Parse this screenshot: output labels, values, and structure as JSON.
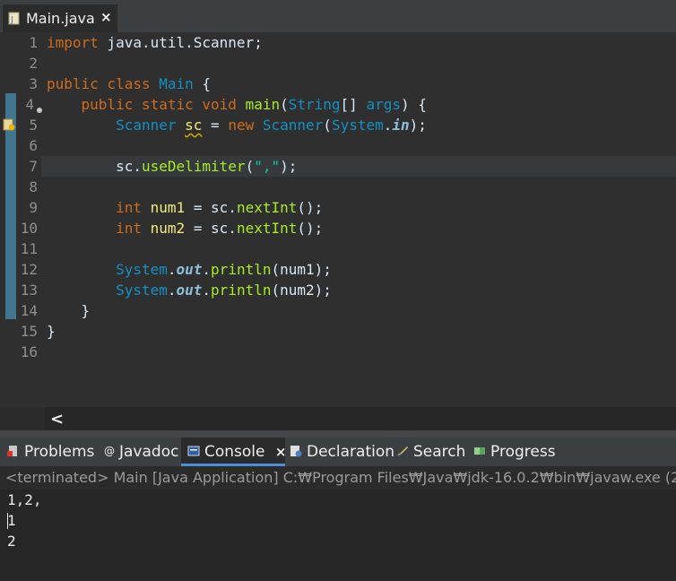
{
  "editor_tab": {
    "title": "Main.java",
    "close": "×"
  },
  "line_numbers": [
    "1",
    "2",
    "3",
    "4",
    "5",
    "6",
    "7",
    "8",
    "9",
    "10",
    "11",
    "12",
    "13",
    "14",
    "15",
    "16"
  ],
  "code": {
    "l1_kw": "import",
    "l1_rest": " java.util.Scanner;",
    "l3_kw1": "public",
    "l3_kw2": "class",
    "l3_cls": "Main",
    "l3_rest": " {",
    "l4_kw1": "public",
    "l4_kw2": "static",
    "l4_kw3": "void",
    "l4_meth": "main",
    "l4_p1": "(",
    "l4_type": "String",
    "l4_p2": "[] ",
    "l4_var": "args",
    "l4_p3": ") {",
    "l5_type1": "Scanner",
    "l5_var": "sc",
    "l5_eq": " = ",
    "l5_kw": "new",
    "l5_type2": "Scanner",
    "l5_p1": "(",
    "l5_sys": "System",
    "l5_dot": ".",
    "l5_stat": "in",
    "l5_p2": ");",
    "l7_a": "sc.",
    "l7_meth": "useDelimiter",
    "l7_p1": "(",
    "l7_str": "\",\"",
    "l7_p2": ");",
    "l9_kw": "int",
    "l9_var": "num1",
    "l9_eq": " = sc.",
    "l9_meth": "nextInt",
    "l9_p": "();",
    "l10_kw": "int",
    "l10_var": "num2",
    "l10_eq": " = sc.",
    "l10_meth": "nextInt",
    "l10_p": "();",
    "l12_sys": "System",
    "l12_dot": ".",
    "l12_stat": "out",
    "l12_dot2": ".",
    "l12_meth": "println",
    "l12_p": "(num1);",
    "l13_sys": "System",
    "l13_dot": ".",
    "l13_stat": "out",
    "l13_dot2": ".",
    "l13_meth": "println",
    "l13_p": "(num2);",
    "l14": "}",
    "l15": "}"
  },
  "scroll_arrow": "<",
  "panel_tabs": {
    "problems": "Problems",
    "javadoc": "Javadoc",
    "console": "Console",
    "console_close": "×",
    "declaration": "Declaration",
    "search": "Search",
    "progress": "Progress"
  },
  "console": {
    "status": "<terminated> Main [Java Application] C:₩Program Files₩Java₩jdk-16.0.2₩bin₩javaw.exe  (2",
    "lines": [
      "1,2,",
      "1",
      "2"
    ]
  },
  "icons": [
    "java-file-icon",
    "close-icon",
    "breakpoint-icon",
    "warning-icon",
    "problems-icon",
    "javadoc-icon",
    "console-icon",
    "declaration-icon",
    "search-icon",
    "progress-icon"
  ]
}
